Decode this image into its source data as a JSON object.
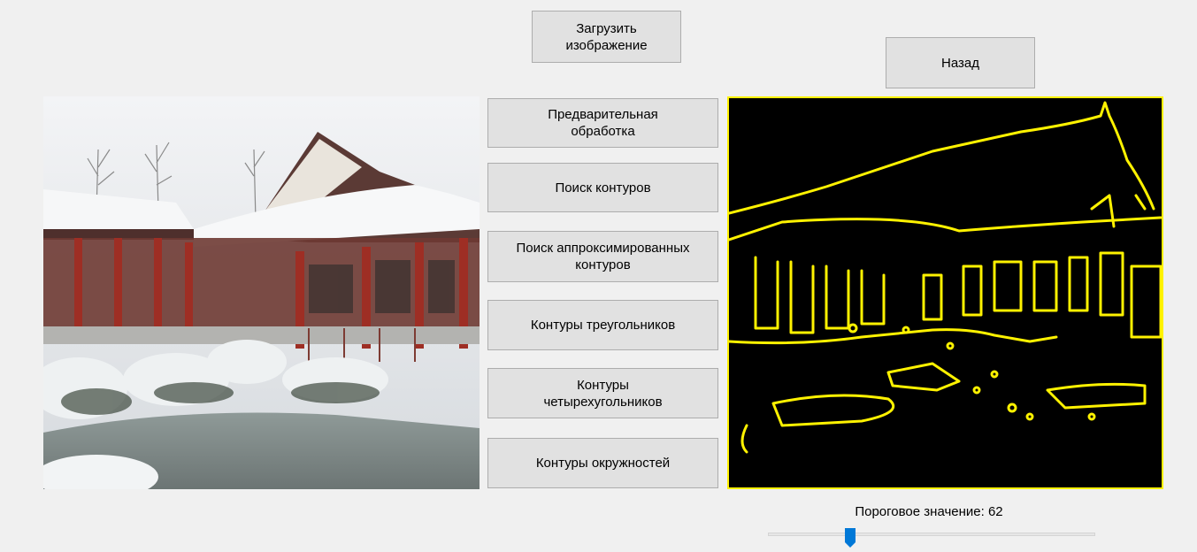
{
  "buttons": {
    "load_image": "Загрузить\nизображение",
    "back": "Назад",
    "preprocessing": "Предварительная\nобработка",
    "find_contours": "Поиск контуров",
    "find_approx_contours": "Поиск аппроксимированных\nконтуров",
    "triangle_contours": "Контуры треугольников",
    "quad_contours": "Контуры\nчетырехугольников",
    "circle_contours": "Контуры окружностей"
  },
  "threshold": {
    "label": "Пороговое значение: 62",
    "value": 62,
    "min": 0,
    "max": 255
  },
  "colors": {
    "contour": "#fff200",
    "result_background": "#000000",
    "slider_thumb": "#0078d7"
  },
  "images": {
    "source": "snowy-chinese-pavilion-photo",
    "result": "yellow-contour-edges"
  }
}
